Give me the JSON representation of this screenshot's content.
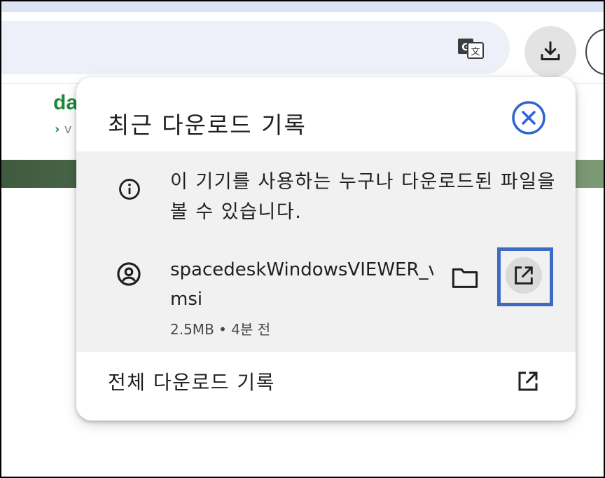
{
  "browser": {
    "download_icon": "download-icon",
    "translate_icon": "translate-icon"
  },
  "background_page": {
    "logo_text": "da",
    "subtitle_arrow": "›",
    "subtitle_text": "v"
  },
  "popup": {
    "title": "최근 다운로드 기록",
    "close_icon": "close-icon",
    "info_banner": {
      "icon": "info-icon",
      "text": "이 기기를 사용하는 누구나 다운로드된 파일을 볼 수 있습니다."
    },
    "download_item": {
      "icon": "account-circle-icon",
      "file_name": "spacedeskWindowsVIEWER_v",
      "file_name_ext": "msi",
      "meta": "2.5MB • 4분 전",
      "folder_icon": "folder-icon",
      "open_icon": "open-in-new-icon"
    },
    "full_history": {
      "label": "전체 다운로드 기록",
      "icon": "open-in-new-icon"
    }
  },
  "colors": {
    "highlight": "#3d6ac4",
    "close_button": "#2f63d4",
    "omnibox": "#edf0f9",
    "banner_bg": "#f1f1f1"
  }
}
